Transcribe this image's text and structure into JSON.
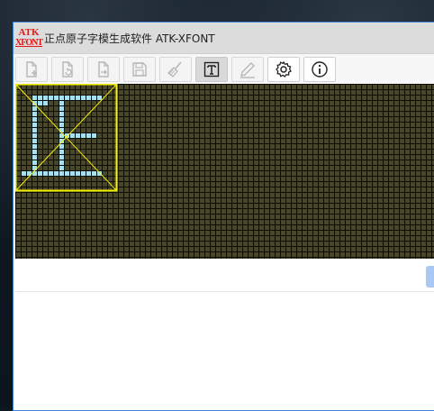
{
  "window": {
    "logo_line1": "ATK",
    "logo_line2": "XFONT",
    "title": "正点原子字模生成软件 ATK-XFONT"
  },
  "toolbar": {
    "buttons": [
      {
        "name": "new-file",
        "state": "disabled"
      },
      {
        "name": "import-file",
        "state": "disabled"
      },
      {
        "name": "export-file",
        "state": "disabled"
      },
      {
        "name": "save",
        "state": "disabled"
      },
      {
        "name": "clear-brush",
        "state": "disabled"
      },
      {
        "name": "text-mode",
        "state": "active"
      },
      {
        "name": "pen-draw",
        "state": "disabled"
      },
      {
        "name": "settings",
        "state": "enabled"
      },
      {
        "name": "about-info",
        "state": "enabled"
      }
    ]
  },
  "canvas": {
    "pixel_color": "#a8e0f0",
    "background_color": "#48472e",
    "guide_color": "#f5f000",
    "preview_glyph": "IF"
  },
  "input": {
    "value": "",
    "placeholder": ""
  },
  "output": {
    "text": ""
  }
}
